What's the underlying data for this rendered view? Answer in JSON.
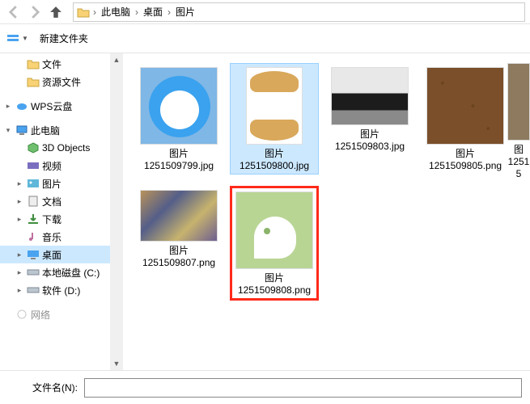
{
  "breadcrumbs": {
    "a": "此电脑",
    "b": "桌面",
    "c": "图片"
  },
  "toolbar": {
    "new_folder": "新建文件夹"
  },
  "sidebar": {
    "items": [
      {
        "label": "文件"
      },
      {
        "label": "资源文件"
      },
      {
        "label": "WPS云盘"
      },
      {
        "label": "此电脑"
      },
      {
        "label": "3D Objects"
      },
      {
        "label": "视频"
      },
      {
        "label": "图片"
      },
      {
        "label": "文档"
      },
      {
        "label": "下载"
      },
      {
        "label": "音乐"
      },
      {
        "label": "桌面"
      },
      {
        "label": "本地磁盘 (C:)"
      },
      {
        "label": "软件 (D:)"
      },
      {
        "label": "网络"
      }
    ]
  },
  "files": {
    "items": [
      {
        "name1": "图片",
        "name2": "1251509799.jpg"
      },
      {
        "name1": "图片",
        "name2": "1251509800.jpg"
      },
      {
        "name1": "图片",
        "name2": "1251509803.jpg"
      },
      {
        "name1": "图片",
        "name2": "1251509805.png"
      },
      {
        "name1": "图",
        "name2": "12515"
      },
      {
        "name1": "图片",
        "name2": "1251509807.png"
      },
      {
        "name1": "图片",
        "name2": "1251509808.png"
      }
    ]
  },
  "bottom": {
    "label": "文件名(N):",
    "value": ""
  }
}
